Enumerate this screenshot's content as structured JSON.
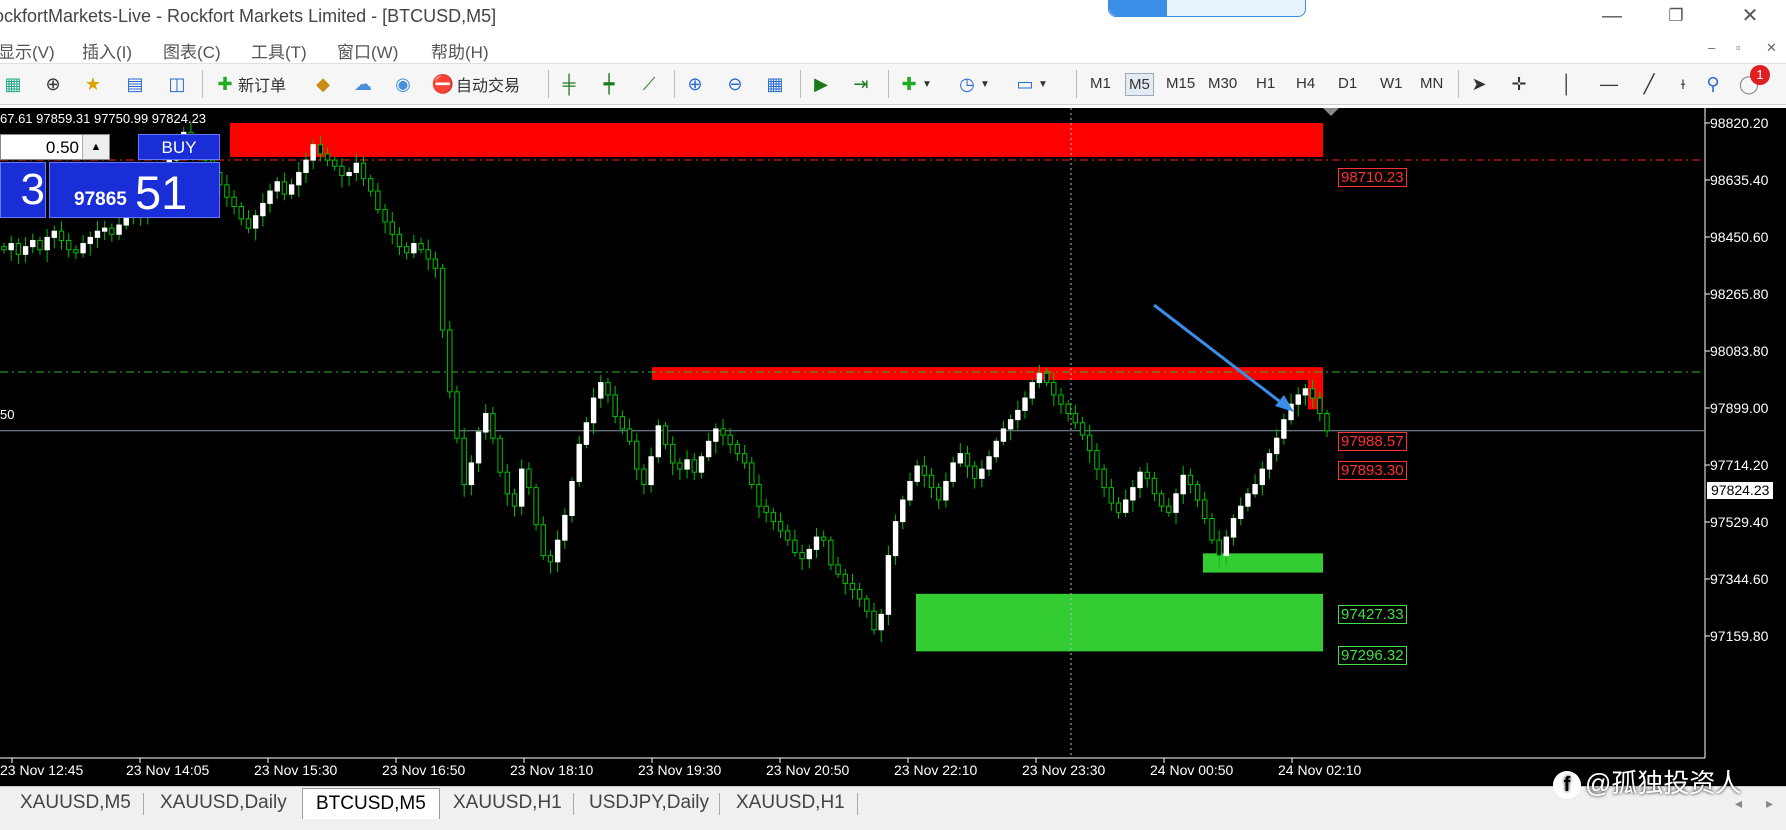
{
  "window": {
    "title": "ockfortMarkets-Live - Rockfort Markets Limited - [BTCUSD,M5]",
    "minimize_glyph": "—",
    "restore_glyph": "❐",
    "close_glyph": "✕"
  },
  "menu": {
    "items": [
      "显示(V)",
      "插入(I)",
      "图表(C)",
      "工具(T)",
      "窗口(W)",
      "帮助(H)"
    ],
    "mdi_minimize": "–",
    "mdi_restore": "▫",
    "mdi_close": "✕"
  },
  "toolbar": {
    "new_order": "新订单",
    "auto_trading": "自动交易",
    "timeframes": [
      "M1",
      "M5",
      "M15",
      "M30",
      "H1",
      "H4",
      "D1",
      "W1",
      "MN"
    ],
    "active_timeframe": "M5",
    "alert_badge": "1"
  },
  "chart": {
    "ohlc_text": "67.61 97859.31 97750.99 97824.23",
    "lot_value": "0.50",
    "lot_spin": "▲",
    "buy_label": "BUY",
    "sell_price_big": "3",
    "buy_price_small": "97865",
    "buy_price_big": "51",
    "left_cut_label": "50",
    "current_price": "97824.23",
    "price_levels": [
      {
        "value": "98710.23",
        "color": "#ff2020"
      },
      {
        "value": "97988.57",
        "color": "#ff2020"
      },
      {
        "value": "97893.30",
        "color": "#ff2020"
      },
      {
        "value": "97427.33",
        "color": "#33cc33"
      },
      {
        "value": "97296.32",
        "color": "#33cc33"
      }
    ],
    "zones": [
      {
        "from": 98710.23,
        "to": 98820.2,
        "color": "#ff0000"
      },
      {
        "from": 97988.57,
        "to": 98030.0,
        "color": "#ff0000"
      },
      {
        "from": 97893.3,
        "to": 97988.57,
        "color": "#ff0000"
      },
      {
        "from": 97365.0,
        "to": 97427.33,
        "color": "#33cc33"
      },
      {
        "from": 97110.0,
        "to": 97296.32,
        "color": "#33cc33"
      }
    ],
    "bull_color": "#ffffff",
    "bear_color": "#00c000",
    "wick_color": "#00c000"
  },
  "chart_data": {
    "type": "candlestick",
    "symbol": "BTCUSD",
    "timeframe": "M5",
    "y_ticks": [
      "98820.20",
      "98635.40",
      "98450.60",
      "98265.80",
      "98083.80",
      "97899.00",
      "97714.20",
      "97529.40",
      "97344.60",
      "97159.80"
    ],
    "x_ticks": [
      "23 Nov 12:45",
      "23 Nov 14:05",
      "23 Nov 15:30",
      "23 Nov 16:50",
      "23 Nov 18:10",
      "23 Nov 19:30",
      "23 Nov 20:50",
      "23 Nov 22:10",
      "23 Nov 23:30",
      "24 Nov 00:50",
      "24 Nov 02:10"
    ],
    "ylim": [
      97110,
      98870
    ],
    "last_close": 97824.23,
    "closes": [
      98410,
      98430,
      98395,
      98420,
      98440,
      98410,
      98450,
      98470,
      98440,
      98410,
      98400,
      98430,
      98450,
      98470,
      98480,
      98460,
      98490,
      98530,
      98560,
      98520,
      98570,
      98600,
      98650,
      98700,
      98760,
      98790,
      98740,
      98730,
      98700,
      98660,
      98620,
      98580,
      98550,
      98510,
      98480,
      98520,
      98560,
      98600,
      98630,
      98590,
      98620,
      98660,
      98700,
      98750,
      98720,
      98700,
      98680,
      98650,
      98660,
      98690,
      98640,
      98600,
      98540,
      98500,
      98460,
      98420,
      98400,
      98430,
      98410,
      98380,
      98350,
      98150,
      97950,
      97800,
      97650,
      97720,
      97820,
      97880,
      97800,
      97690,
      97620,
      97580,
      97700,
      97640,
      97520,
      97420,
      97400,
      97470,
      97550,
      97660,
      97780,
      97850,
      97930,
      97980,
      97940,
      97870,
      97830,
      97790,
      97700,
      97650,
      97740,
      97840,
      97780,
      97720,
      97700,
      97730,
      97690,
      97740,
      97790,
      97830,
      97810,
      97780,
      97750,
      97720,
      97650,
      97580,
      97560,
      97530,
      97500,
      97470,
      97430,
      97410,
      97440,
      97480,
      97470,
      97390,
      97360,
      97330,
      97310,
      97280,
      97240,
      97180,
      97230,
      97420,
      97530,
      97600,
      97660,
      97710,
      97680,
      97640,
      97600,
      97660,
      97720,
      97750,
      97710,
      97670,
      97700,
      97740,
      97790,
      97830,
      97860,
      97890,
      97930,
      97980,
      98010,
      97980,
      97940,
      97910,
      97880,
      97850,
      97810,
      97760,
      97700,
      97640,
      97590,
      97560,
      97600,
      97640,
      97690,
      97670,
      97620,
      97580,
      97560,
      97620,
      97680,
      97650,
      97600,
      97540,
      97470,
      97420,
      97480,
      97540,
      97580,
      97620,
      97650,
      97700,
      97750,
      97800,
      97860,
      97910,
      97940,
      97960,
      97930,
      97880,
      97824
    ]
  },
  "tabs": {
    "items": [
      "XAUUSD,M5",
      "XAUUSD,Daily",
      "BTCUSD,M5",
      "XAUUSD,H1",
      "USDJPY,Daily",
      "XAUUSD,H1"
    ],
    "active_index": 2,
    "scroll_left": "◂",
    "scroll_right": "▸"
  },
  "watermark": {
    "logo": "f",
    "text": "@孤独投资人"
  }
}
